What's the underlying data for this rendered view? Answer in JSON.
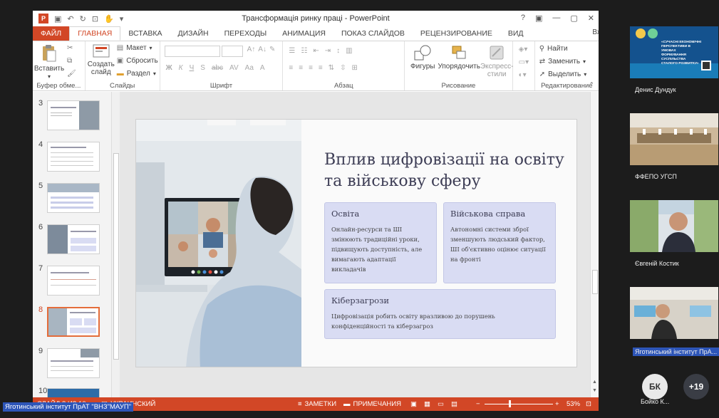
{
  "app": {
    "title": "Трансформація ринку праці - PowerPoint",
    "login": "Вход"
  },
  "window_controls": [
    "?",
    "▣",
    "—",
    "▢",
    "✕"
  ],
  "tabs": [
    "ФАЙЛ",
    "ГЛАВНАЯ",
    "ВСТАВКА",
    "ДИЗАЙН",
    "ПЕРЕХОДЫ",
    "АНИМАЦИЯ",
    "ПОКАЗ СЛАЙДОВ",
    "РЕЦЕНЗИРОВАНИЕ",
    "ВИД"
  ],
  "ribbon": {
    "clipboard": {
      "paste": "Вставить",
      "label": "Буфер обме..."
    },
    "slides": {
      "create": "Создать",
      "create2": "слайд",
      "layout": "Макет",
      "reset": "Сбросить",
      "section": "Раздел",
      "label": "Слайды"
    },
    "font": {
      "label": "Шрифт",
      "bold": "Ж",
      "italic": "К",
      "underline": "Ч",
      "strike": "S",
      "abc": "abc",
      "spacing": "AV",
      "case": "Aa",
      "color": "A"
    },
    "paragraph": {
      "label": "Абзац"
    },
    "drawing": {
      "shapes": "Фигуры",
      "arrange": "Упорядочить",
      "styles": "Экспресс-",
      "styles2": "стили",
      "label": "Рисование"
    },
    "editing": {
      "find": "Найти",
      "replace": "Заменить",
      "select": "Выделить",
      "label": "Редактирование"
    }
  },
  "thumbnails": [
    {
      "num": "3"
    },
    {
      "num": "4"
    },
    {
      "num": "5"
    },
    {
      "num": "6"
    },
    {
      "num": "7"
    },
    {
      "num": "8",
      "active": true
    },
    {
      "num": "9"
    },
    {
      "num": "10"
    }
  ],
  "slide": {
    "title": "Вплив цифровізації на освіту та військову сферу",
    "cards": [
      {
        "title": "Освіта",
        "text": "Онлайн-ресурси та ШІ змінюють традиційні уроки, підвищують доступність, але вимагають адаптації викладачів"
      },
      {
        "title": "Військова справа",
        "text": "Автономні системи зброї зменшують людський фактор, ШІ об'єктивно оцінює ситуації на фронті"
      },
      {
        "title": "Кібер­загрози",
        "text": "Цифровізація робить освіту вразливою до порушень конфіденційності та кіберзагроз"
      }
    ]
  },
  "status": {
    "slide_info": "СЛАЙД 8 ИЗ 10",
    "language": "УКРАИНСКИЙ",
    "notes": "ЗАМЕТКИ",
    "comments": "ПРИМЕЧАНИЯ",
    "zoom": "53%"
  },
  "participants": [
    {
      "name": "Денис Дундук"
    },
    {
      "name": "ФФЕПО УГСП"
    },
    {
      "name": "Євгеній Костик"
    },
    {
      "name": "Яготинський інститут ПрА..."
    }
  ],
  "banner_text": {
    "line1": "«СУЧАСНІ ЕКОНОМІЧНІ",
    "line2": "ПЕРСПЕКТИВИ В УМОВАХ",
    "line3": "ФОРМУВАННЯ СУСПІЛЬСТВА",
    "line4": "СТАЛОГО РОЗВИТКУ»"
  },
  "bottom_bar": {
    "avatar_initials": "БК",
    "avatar_name": "Бойко К...",
    "more_count": "+19"
  },
  "bottom_banner": "Яготинський інститут ПрАТ \"ВНЗ\"МАУП\""
}
